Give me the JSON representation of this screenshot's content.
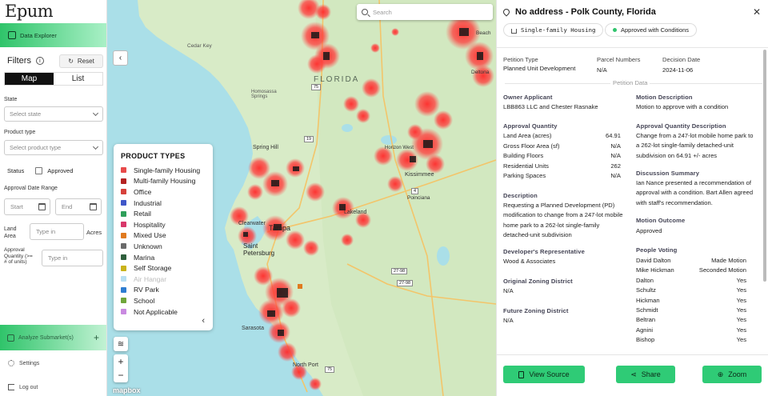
{
  "app": {
    "logo": "Epum"
  },
  "nav": {
    "data_explorer": "Data Explorer",
    "analyze": "Analyze Submarket(s)",
    "settings": "Settings",
    "logout": "Log out"
  },
  "filters": {
    "title": "Filters",
    "reset": "Reset",
    "view_map": "Map",
    "view_list": "List",
    "state_label": "State",
    "state_placeholder": "Select state",
    "product_label": "Product type",
    "product_placeholder": "Select product type",
    "status_label": "Status",
    "approved_label": "Approved",
    "approval_date_label": "Approval Date Range",
    "start_placeholder": "Start",
    "end_placeholder": "End",
    "land_area_label": "Land Area",
    "land_area_placeholder": "Type in",
    "land_area_unit": "Acres",
    "approval_qty_label": "Approval Quantity (>= # of units)",
    "approval_qty_placeholder": "Type in"
  },
  "map": {
    "search_placeholder": "Search",
    "attribution": "mapbox",
    "labels": [
      "FLORIDA",
      "Cedar Key",
      "Homosassa Springs",
      "Spring Hill",
      "Clearwater",
      "Saint Petersburg",
      "Tampa",
      "Lakeland",
      "Kissimmee",
      "Poinciana",
      "Horizon West",
      "Sarasota",
      "North Port",
      "Deltona",
      "Beach"
    ],
    "routes": [
      "75",
      "19",
      "4",
      "27-98",
      "27-98",
      "75"
    ],
    "legend": {
      "title": "PRODUCT TYPES",
      "items": [
        {
          "label": "Single-family Housing",
          "color": "#e84a4a",
          "dim": false
        },
        {
          "label": "Multi-family Housing",
          "color": "#b42222",
          "dim": false
        },
        {
          "label": "Office",
          "color": "#d6413b",
          "dim": false
        },
        {
          "label": "Industrial",
          "color": "#3f57c9",
          "dim": false
        },
        {
          "label": "Retail",
          "color": "#2f9f5a",
          "dim": false
        },
        {
          "label": "Hospitality",
          "color": "#d8376a",
          "dim": false
        },
        {
          "label": "Mixed Use",
          "color": "#e07a1f",
          "dim": false
        },
        {
          "label": "Unknown",
          "color": "#6a6a6a",
          "dim": false
        },
        {
          "label": "Marina",
          "color": "#2f5f3c",
          "dim": false
        },
        {
          "label": "Self Storage",
          "color": "#c9b21b",
          "dim": false
        },
        {
          "label": "Air Hangar",
          "color": "#b8dff2",
          "dim": true
        },
        {
          "label": "RV Park",
          "color": "#2e7dd1",
          "dim": false
        },
        {
          "label": "School",
          "color": "#6fa63a",
          "dim": false
        },
        {
          "label": "Not Applicable",
          "color": "#c98ae0",
          "dim": false
        }
      ]
    }
  },
  "detail": {
    "title": "No address - Polk County, Florida",
    "chip_type": "Single-family Housing",
    "chip_status": "Approved with Conditions",
    "petition_type_label": "Petition Type",
    "petition_type": "Planned Unit Development",
    "parcel_label": "Parcel Numbers",
    "parcel": "N/A",
    "decision_label": "Decision Date",
    "decision": "2024-11-06",
    "section": "Petition Data",
    "owner_label": "Owner Applicant",
    "owner": "LBB863 LLC and Chester Rasnake",
    "motion_desc_label": "Motion Description",
    "motion_desc": "Motion to approve with a condition",
    "aq_label": "Approval Quantity",
    "aq": [
      {
        "k": "Land Area (acres)",
        "v": "64.91"
      },
      {
        "k": "Gross Floor Area (sf)",
        "v": "N/A"
      },
      {
        "k": "Building Floors",
        "v": "N/A"
      },
      {
        "k": "Residential Units",
        "v": "262"
      },
      {
        "k": "Parking Spaces",
        "v": "N/A"
      }
    ],
    "aqd_label": "Approval Quantity Description",
    "aqd": "Change from a 247-lot mobile home park to a 262-lot single-family detached-unit subdivision on 64.91 +/- acres",
    "desc_label": "Description",
    "desc": "Requesting a Planned Development (PD) modification to change from a 247-lot mobile home park to a 262-lot single-family detached-unit subdivision",
    "discussion_label": "Discussion Summary",
    "discussion": "Ian Nance presented a recommendation of approval with a condition. Bart Allen agreed with staff's recommendation.",
    "rep_label": "Developer's Representative",
    "rep": "Wood & Associates",
    "outcome_label": "Motion Outcome",
    "outcome": "Approved",
    "orig_zoning_label": "Original Zoning District",
    "orig_zoning": "N/A",
    "voting_label": "People Voting",
    "voting": [
      {
        "name": "David Dalton",
        "vote": "Made Motion"
      },
      {
        "name": "Mike Hickman",
        "vote": "Seconded Motion"
      },
      {
        "name": "Dalton",
        "vote": "Yes"
      },
      {
        "name": "Schultz",
        "vote": "Yes"
      },
      {
        "name": "Hickman",
        "vote": "Yes"
      },
      {
        "name": "Schmidt",
        "vote": "Yes"
      },
      {
        "name": "Beltran",
        "vote": "Yes"
      },
      {
        "name": "Agnini",
        "vote": "Yes"
      },
      {
        "name": "Bishop",
        "vote": "Yes"
      }
    ],
    "future_zoning_label": "Future Zoning District",
    "future_zoning": "N/A",
    "btn_view": "View Source",
    "btn_share": "Share",
    "btn_zoom": "Zoom"
  }
}
